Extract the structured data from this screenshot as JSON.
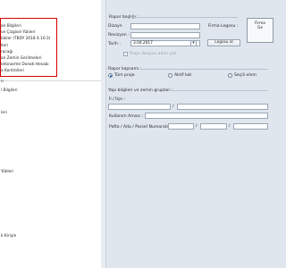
{
  "tree": {
    "items": [
      "an Bilgileri",
      "ve Çizgisel Yükleri",
      "lükler (TBDY 2018 4.10.3)",
      "lleri",
      "racağı",
      "an Zemin Gerilmeleri",
      "letonarme Donatı Hesabı",
      "a Kontrolleri",
      "n",
      "l Bilgileri",
      "leri",
      "Yükleri",
      "k Kiriş/e"
    ]
  },
  "form": {
    "rapor_basligi_label": "Rapor başlığı :",
    "dizayn_label": "Dizayn",
    "revizyon_label": "Revizyon :",
    "tarih_label": "Tarih :",
    "tarih_value": "3.04.2017",
    "firma_logosu_label": "Firma Logosu :",
    "logosu_al_label": "Logosu al",
    "logo_box_line1": "Firma",
    "logo_box_line2": "Ge",
    "proje_checkbox_label": "Proje dosyası adını yaz",
    "rapor_kapsami_label": "Rapor kapsamı :",
    "radio_tum_proje": "Tüm proje",
    "radio_aktif_kat": "Aktif kat",
    "radio_secili": "Seçili elem",
    "yapi_bilgileri_label": "Yapı bilgileri ve zemin grupları :",
    "il_ilce_label": "İl / İlçe :",
    "kullanim_label": "Kullanım Amacı :",
    "pafta_label": "Pafta / Ada / Parsel Numaraları :",
    "slash": "/"
  }
}
